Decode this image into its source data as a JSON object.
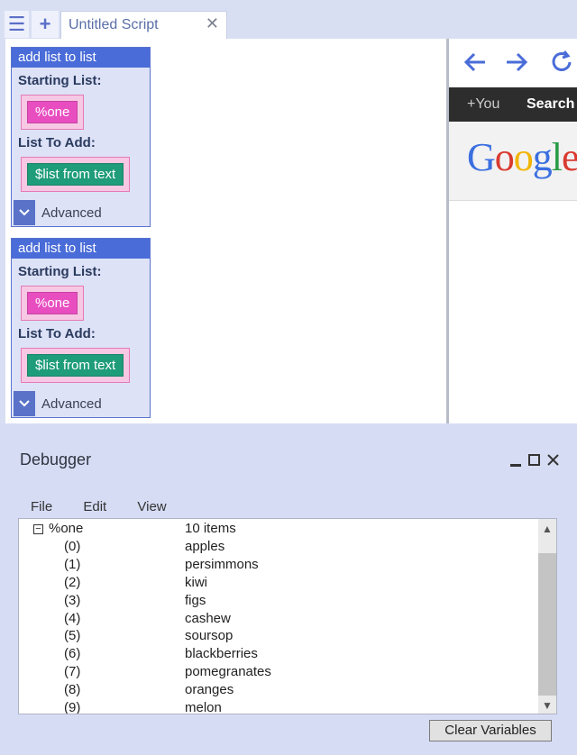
{
  "tabs": {
    "active_title": "Untitled Script",
    "menu_icon": "hamburger-icon",
    "add_icon": "plus-icon",
    "close_icon": "close-icon"
  },
  "blocks": [
    {
      "header": "add list to list",
      "starting_label": "Starting List:",
      "starting_value": "%one",
      "add_label": "List To Add:",
      "add_value": "$list from text",
      "advanced_label": "Advanced"
    },
    {
      "header": "add list to list",
      "starting_label": "Starting List:",
      "starting_value": "%one",
      "add_label": "List To Add:",
      "add_value": "$list from text",
      "advanced_label": "Advanced"
    }
  ],
  "browser": {
    "nav_icons": [
      "back-arrow-icon",
      "forward-arrow-icon",
      "refresh-icon"
    ],
    "gbar_you": "+You",
    "gbar_search": "Search",
    "logo_text": "Google"
  },
  "debugger": {
    "title": "Debugger",
    "menu": [
      "File",
      "Edit",
      "View"
    ],
    "root": {
      "name": "%one",
      "summary": "10 items"
    },
    "items": [
      {
        "index": "(0)",
        "value": "apples"
      },
      {
        "index": "(1)",
        "value": "persimmons"
      },
      {
        "index": "(2)",
        "value": "kiwi"
      },
      {
        "index": "(3)",
        "value": "figs"
      },
      {
        "index": "(4)",
        "value": "cashew"
      },
      {
        "index": "(5)",
        "value": "soursop"
      },
      {
        "index": "(6)",
        "value": "blackberries"
      },
      {
        "index": "(7)",
        "value": "pomegranates"
      },
      {
        "index": "(8)",
        "value": "oranges"
      },
      {
        "index": "(9)",
        "value": "melon"
      }
    ],
    "clear_button": "Clear Variables"
  },
  "colors": {
    "accent": "#4a6cd8",
    "chip_pink": "#e84ec0",
    "chip_green": "#1f9c7a"
  }
}
